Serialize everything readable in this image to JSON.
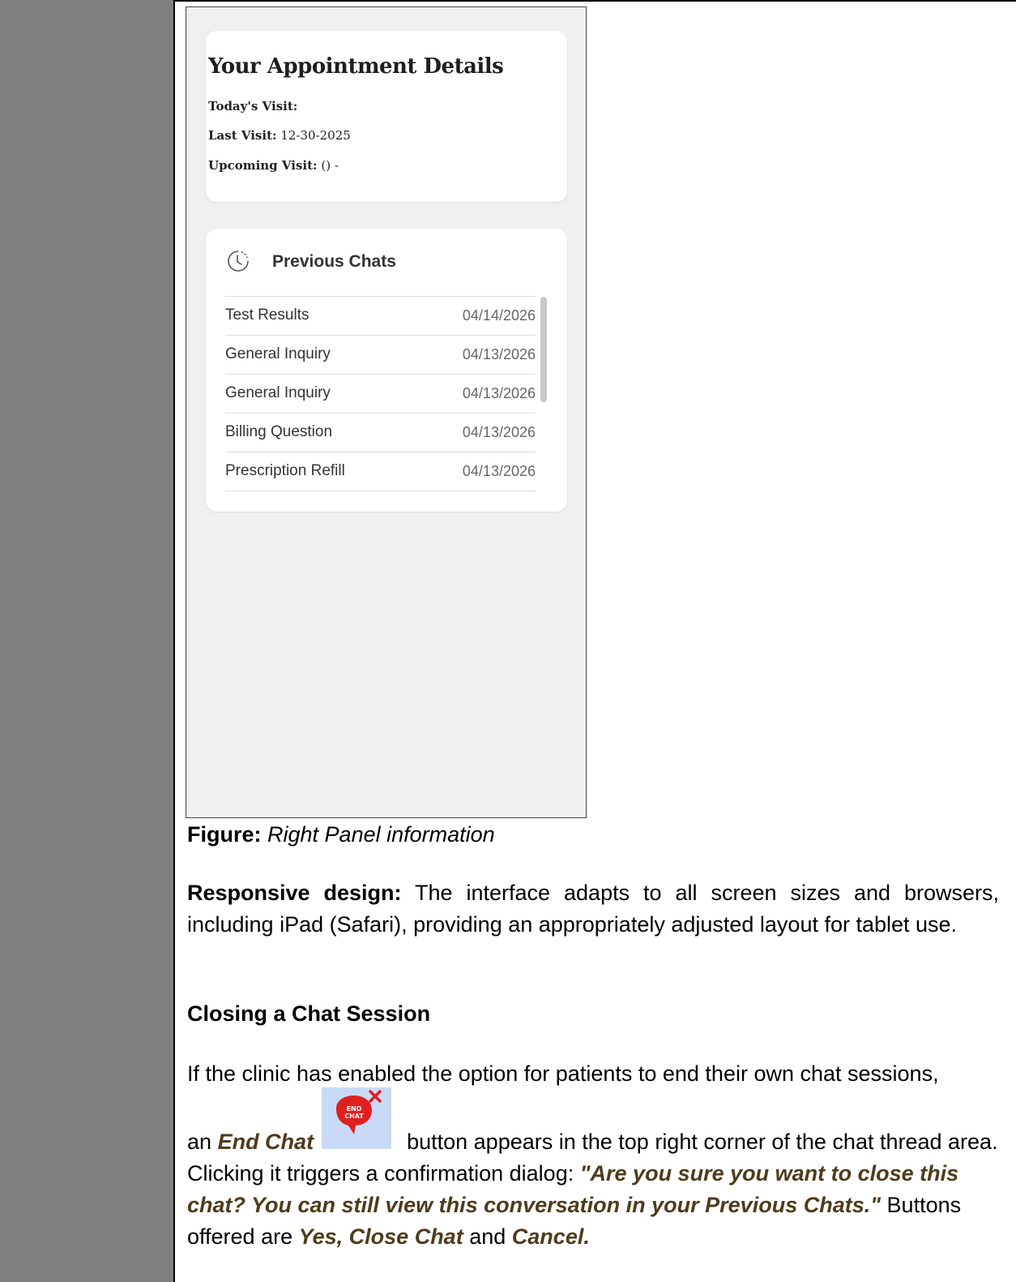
{
  "appointment": {
    "title": "Your Appointment Details",
    "todays_visit_label": "Today's Visit:",
    "todays_visit_value": "",
    "last_visit_label": "Last Visit:",
    "last_visit_value": "12-30-2025",
    "upcoming_visit_label": "Upcoming Visit:",
    "upcoming_visit_value": "() -"
  },
  "previous_chats": {
    "title": "Previous Chats",
    "items": [
      {
        "topic": "Test Results",
        "date": "04/14/2026"
      },
      {
        "topic": "General Inquiry",
        "date": "04/13/2026"
      },
      {
        "topic": "General Inquiry",
        "date": "04/13/2026"
      },
      {
        "topic": "Billing Question",
        "date": "04/13/2026"
      },
      {
        "topic": "Prescription Refill",
        "date": "04/13/2026"
      }
    ]
  },
  "figure": {
    "label": "Figure:",
    "caption": "Right Panel information"
  },
  "responsive": {
    "label": "Responsive design:",
    "text": "The interface adapts to all screen sizes and browsers, including iPad (Safari), providing an appropriately adjusted layout for tablet use."
  },
  "closing": {
    "heading": "Closing a Chat Session",
    "line1": "If the clinic has enabled the option for patients to end their own chat sessions,",
    "an": "an",
    "end_chat": "End Chat",
    "text_after_icon": "button appears in the top right corner of the chat thread area. Clicking it triggers a confirmation dialog:",
    "dialog_quote": "\"Are you sure you want to close this chat? You can still view this conversation in your Previous Chats.\"",
    "buttons_offered": "Buttons offered are",
    "yes_close": "Yes, Close Chat",
    "and": "and",
    "cancel": "Cancel."
  },
  "end_chat_icon": {
    "text_line1": "END",
    "text_line2": "CHAT",
    "bubble_color": "#e02020",
    "x_color": "#e02020",
    "bg_color": "#c9daf8"
  }
}
